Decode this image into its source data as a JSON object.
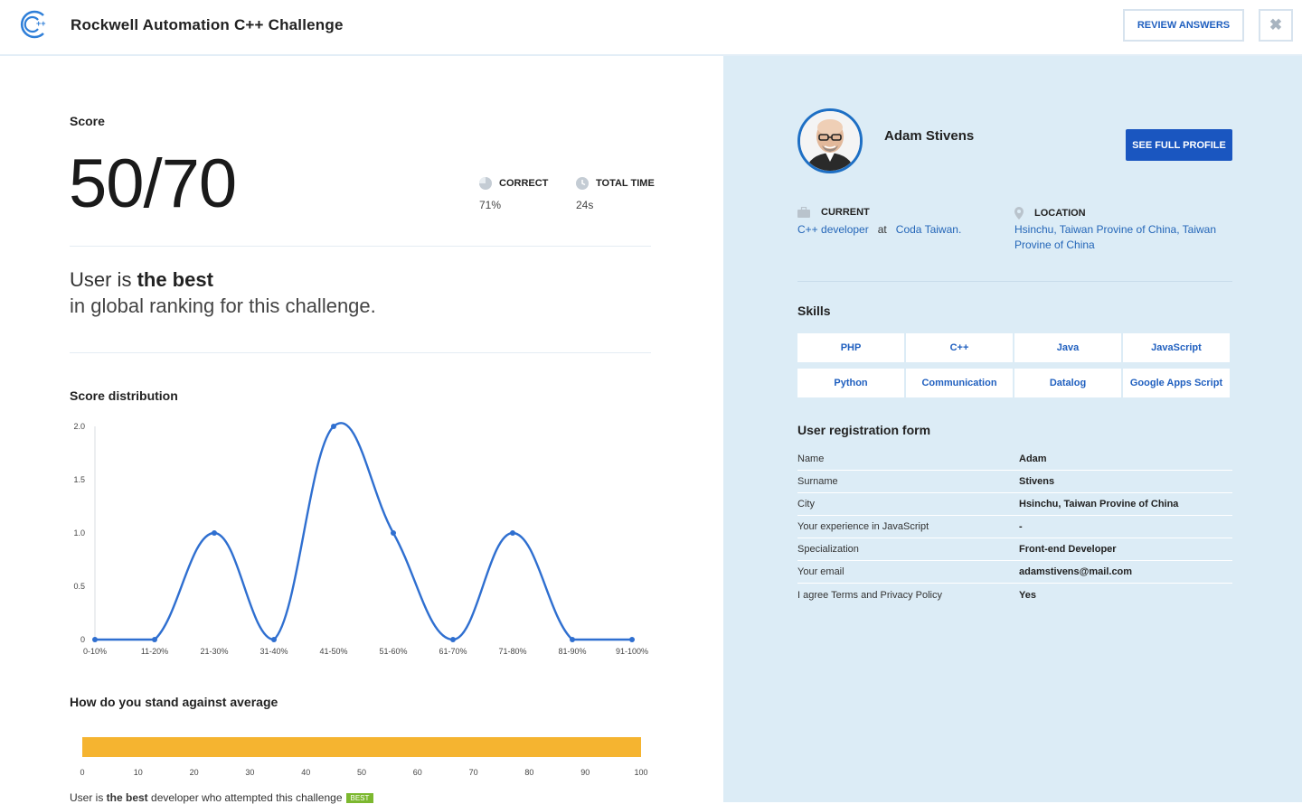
{
  "header": {
    "title": "Rockwell Automation C++ Challenge",
    "review_label": "REVIEW ANSWERS",
    "close_glyph": "✖"
  },
  "score": {
    "section_title": "Score",
    "value": "50/70",
    "correct_label": "CORRECT",
    "correct_value": "71%",
    "time_label": "TOTAL TIME",
    "time_value": "24s"
  },
  "ranking": {
    "line1_prefix": "User is ",
    "line1_bold": "the best",
    "line2": "in global ranking for this challenge."
  },
  "chart_data": [
    {
      "type": "line",
      "title": "Score distribution",
      "categories": [
        "0-10%",
        "11-20%",
        "21-30%",
        "31-40%",
        "41-50%",
        "51-60%",
        "61-70%",
        "71-80%",
        "81-90%",
        "91-100%"
      ],
      "values": [
        0,
        0,
        1,
        0,
        2,
        1,
        0,
        1,
        0,
        0
      ],
      "ylim": [
        0,
        2
      ],
      "yticks": [
        "0",
        "0.5",
        "1.0",
        "1.5",
        "2.0"
      ],
      "color": "#2f6fd0"
    },
    {
      "type": "bar",
      "title": "How do you stand against average",
      "values": [
        100
      ],
      "xlim": [
        0,
        100
      ],
      "xticks": [
        "0",
        "10",
        "20",
        "30",
        "40",
        "50",
        "60",
        "70",
        "80",
        "90",
        "100"
      ],
      "color": "#f5b430"
    }
  ],
  "standing": {
    "note_prefix": "User is ",
    "note_bold": "the best",
    "note_suffix": " developer who attempted this challenge",
    "badge": "BEST"
  },
  "profile": {
    "name": "Adam Stivens",
    "see_profile_label": "SEE FULL PROFILE",
    "current_label": "CURRENT",
    "role": "C++ developer",
    "at": "at",
    "company": "Coda Taiwan.",
    "location_label": "LOCATION",
    "location_line1": "Hsinchu, Taiwan Provine of China, Taiwan",
    "location_line2": "Provine of China"
  },
  "skills": {
    "title": "Skills",
    "items": [
      "PHP",
      "C++",
      "Java",
      "JavaScript",
      "Python",
      "Communication",
      "Datalog",
      "Google Apps Script"
    ]
  },
  "registration": {
    "title": "User registration form",
    "rows": [
      {
        "k": "Name",
        "v": "Adam"
      },
      {
        "k": "Surname",
        "v": "Stivens"
      },
      {
        "k": "City",
        "v": "Hsinchu, Taiwan Provine of China"
      },
      {
        "k": "Your experience in JavaScript",
        "v": "-"
      },
      {
        "k": "Specialization",
        "v": "Front-end Developer"
      },
      {
        "k": "Your email",
        "v": "adamstivens@mail.com"
      },
      {
        "k": "I agree Terms and Privacy Policy",
        "v": "Yes"
      }
    ]
  },
  "colors": {
    "accent": "#1a56c0",
    "right_panel": "#dcecf6",
    "line": "#2f6fd0",
    "bar": "#f5b430",
    "badge": "#7cb82f"
  }
}
